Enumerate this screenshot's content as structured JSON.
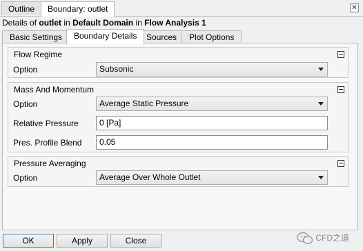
{
  "top_tabs": [
    {
      "label": "Outline",
      "active": false
    },
    {
      "label": "Boundary: outlet",
      "active": true
    }
  ],
  "details": {
    "prefix": "Details of",
    "object": "outlet",
    "in1": "in",
    "domain": "Default Domain",
    "in2": "in",
    "analysis": "Flow Analysis 1"
  },
  "sub_tabs": [
    {
      "label": "Basic Settings",
      "active": false
    },
    {
      "label": "Boundary Details",
      "active": true
    },
    {
      "label": "Sources",
      "active": false
    },
    {
      "label": "Plot Options",
      "active": false
    }
  ],
  "flow_regime": {
    "title": "Flow Regime",
    "option_label": "Option",
    "option_value": "Subsonic"
  },
  "mass_momentum": {
    "title": "Mass And Momentum",
    "option_label": "Option",
    "option_value": "Average Static Pressure",
    "relative_pressure_label": "Relative Pressure",
    "relative_pressure_value": "0 [Pa]",
    "profile_blend_label": "Pres. Profile Blend",
    "profile_blend_value": "0.05"
  },
  "pressure_averaging": {
    "title": "Pressure Averaging",
    "option_label": "Option",
    "option_value": "Average Over Whole Outlet"
  },
  "buttons": {
    "ok": "OK",
    "apply": "Apply",
    "close": "Close"
  },
  "watermark": "CFD之道",
  "icons": {
    "close": "close-icon",
    "collapse": "minus-box-icon",
    "dropdown": "chevron-down-icon"
  }
}
